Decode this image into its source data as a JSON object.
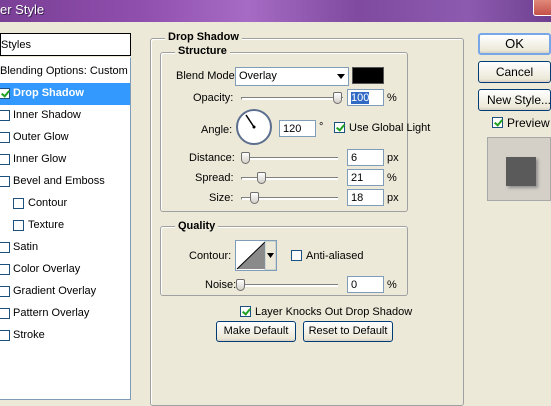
{
  "window": {
    "title": "er Style"
  },
  "styles_panel": {
    "header": "Styles",
    "blending_options": "Blending Options: Custom",
    "items": [
      {
        "label": "Drop Shadow",
        "checked": true,
        "selected": true,
        "sub": false
      },
      {
        "label": "Inner Shadow",
        "checked": false,
        "selected": false,
        "sub": false
      },
      {
        "label": "Outer Glow",
        "checked": false,
        "selected": false,
        "sub": false
      },
      {
        "label": "Inner Glow",
        "checked": false,
        "selected": false,
        "sub": false
      },
      {
        "label": "Bevel and Emboss",
        "checked": false,
        "selected": false,
        "sub": false
      },
      {
        "label": "Contour",
        "checked": false,
        "selected": false,
        "sub": true
      },
      {
        "label": "Texture",
        "checked": false,
        "selected": false,
        "sub": true
      },
      {
        "label": "Satin",
        "checked": false,
        "selected": false,
        "sub": false
      },
      {
        "label": "Color Overlay",
        "checked": false,
        "selected": false,
        "sub": false
      },
      {
        "label": "Gradient Overlay",
        "checked": false,
        "selected": false,
        "sub": false
      },
      {
        "label": "Pattern Overlay",
        "checked": false,
        "selected": false,
        "sub": false
      },
      {
        "label": "Stroke",
        "checked": false,
        "selected": false,
        "sub": false
      }
    ]
  },
  "drop_shadow": {
    "title": "Drop Shadow",
    "structure": {
      "title": "Structure",
      "blend_mode_label": "Blend Mode:",
      "blend_mode_value": "Overlay",
      "shadow_color": "#000000",
      "opacity_label": "Opacity:",
      "opacity_value": "100",
      "opacity_unit": "%",
      "angle_label": "Angle:",
      "angle_value": "120",
      "angle_unit": "°",
      "use_global_light_label": "Use Global Light",
      "use_global_light_checked": true,
      "distance_label": "Distance:",
      "distance_value": "6",
      "distance_unit": "px",
      "spread_label": "Spread:",
      "spread_value": "21",
      "spread_unit": "%",
      "size_label": "Size:",
      "size_value": "18",
      "size_unit": "px"
    },
    "quality": {
      "title": "Quality",
      "contour_label": "Contour:",
      "anti_aliased_label": "Anti-aliased",
      "anti_aliased_checked": false,
      "noise_label": "Noise:",
      "noise_value": "0",
      "noise_unit": "%"
    },
    "layer_knocks_out_label": "Layer Knocks Out Drop Shadow",
    "layer_knocks_out_checked": true,
    "make_default_label": "Make Default",
    "reset_to_default_label": "Reset to Default"
  },
  "actions": {
    "ok_label": "OK",
    "cancel_label": "Cancel",
    "new_style_label": "New Style...",
    "preview_label": "Preview",
    "preview_checked": true
  }
}
